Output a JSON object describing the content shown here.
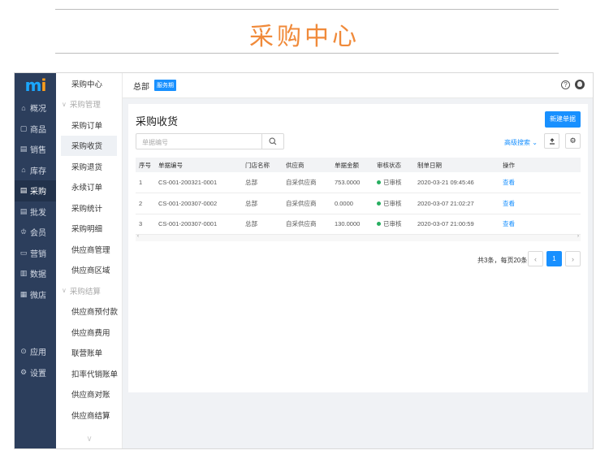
{
  "banner": {
    "title": "采购中心"
  },
  "app": {
    "logo": "mi",
    "sidebar": {
      "items": [
        {
          "icon": "home-icon",
          "glyph": "⌂",
          "label": "概况"
        },
        {
          "icon": "goods-icon",
          "glyph": "▢",
          "label": "商品"
        },
        {
          "icon": "sales-icon",
          "glyph": "▤",
          "label": "销售"
        },
        {
          "icon": "warehouse-icon",
          "glyph": "⌂",
          "label": "库存"
        },
        {
          "icon": "purchase-icon",
          "glyph": "▤",
          "label": "采购",
          "active": true
        },
        {
          "icon": "wholesale-icon",
          "glyph": "▤",
          "label": "批发"
        },
        {
          "icon": "member-icon",
          "glyph": "♔",
          "label": "会员"
        },
        {
          "icon": "marketing-icon",
          "glyph": "▭",
          "label": "营销"
        },
        {
          "icon": "data-icon",
          "glyph": "▥",
          "label": "数据"
        },
        {
          "icon": "store-icon",
          "glyph": "▦",
          "label": "微店"
        }
      ],
      "bottom": [
        {
          "icon": "apps-icon",
          "glyph": "⊙",
          "label": "应用"
        },
        {
          "icon": "settings-icon",
          "glyph": "⚙",
          "label": "设置"
        }
      ]
    },
    "subnav": {
      "top": "采购中心",
      "group1": "采购管理",
      "group1_items": [
        "采购订单",
        "采购收货",
        "采购退货",
        "永续订单",
        "采购统计",
        "采购明细",
        "供应商管理",
        "供应商区域"
      ],
      "group2": "采购结算",
      "group2_items": [
        "供应商预付款",
        "供应商费用",
        "联营账单",
        "扣率代销账单",
        "供应商对账",
        "供应商结算"
      ]
    },
    "topbar": {
      "org": "总部",
      "badge": "服务期"
    },
    "page": {
      "title": "采购收货",
      "new_button": "新建单据",
      "search_placeholder": "单据编号",
      "advanced_search": "高级搜索",
      "columns": [
        "序号",
        "单据编号",
        "门店名称",
        "供应商",
        "单据金额",
        "审核状态",
        "制单日期",
        "操作"
      ],
      "rows": [
        [
          "1",
          "CS-001-200321-0001",
          "总部",
          "自采供应商",
          "753.0000",
          "已审核",
          "2020-03-21 09:45:46",
          "查看"
        ],
        [
          "2",
          "CS-001-200307-0002",
          "总部",
          "自采供应商",
          "0.0000",
          "已审核",
          "2020-03-07 21:02:27",
          "查看"
        ],
        [
          "3",
          "CS-001-200307-0001",
          "总部",
          "自采供应商",
          "130.0000",
          "已审核",
          "2020-03-07 21:00:59",
          "查看"
        ]
      ],
      "status_color": "#27ae60",
      "pager": {
        "summary": "共3条，每页20条",
        "current": "1"
      }
    },
    "accent_color": "#1890ff"
  }
}
